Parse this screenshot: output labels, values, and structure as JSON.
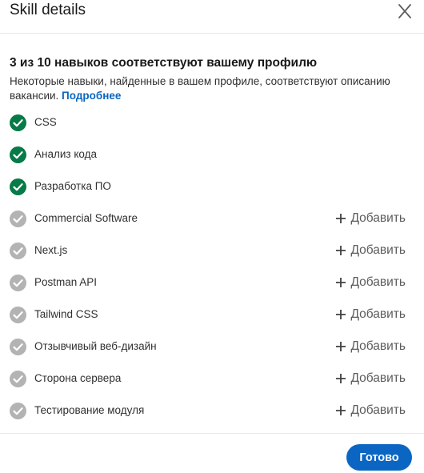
{
  "dialog": {
    "title": "Skill details",
    "close_icon": "close-icon"
  },
  "summary": {
    "heading": "3 из 10 навыков соответствуют вашему профилю",
    "description": "Некоторые навыки, найденные в вашем профиле, соответствуют описанию вакансии.",
    "more_link": "Подробнее"
  },
  "skills": [
    {
      "name": "CSS",
      "matched": true
    },
    {
      "name": "Анализ кода",
      "matched": true
    },
    {
      "name": "Разработка ПО",
      "matched": true
    },
    {
      "name": "Commercial Software",
      "matched": false,
      "action": "Добавить"
    },
    {
      "name": "Next.js",
      "matched": false,
      "action": "Добавить"
    },
    {
      "name": "Postman API",
      "matched": false,
      "action": "Добавить"
    },
    {
      "name": "Tailwind CSS",
      "matched": false,
      "action": "Добавить"
    },
    {
      "name": "Отзывчивый веб-дизайн",
      "matched": false,
      "action": "Добавить"
    },
    {
      "name": "Сторона сервера",
      "matched": false,
      "action": "Добавить"
    },
    {
      "name": "Тестирование модуля",
      "matched": false,
      "action": "Добавить"
    }
  ],
  "footer": {
    "done_label": "Готово"
  },
  "colors": {
    "accent": "#0a66c2",
    "matched": "#067a47",
    "unmatched": "#b3b3b3"
  }
}
